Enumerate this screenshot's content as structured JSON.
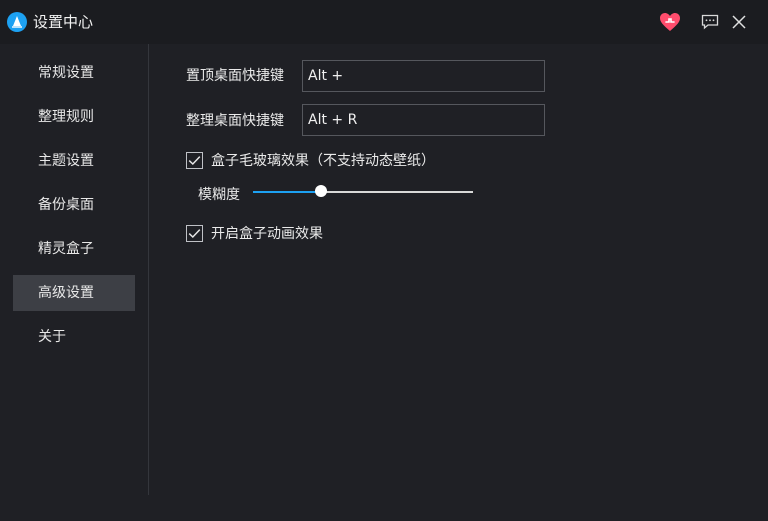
{
  "window": {
    "title": "设置中心",
    "icons": {
      "logo": "app-logo-icon",
      "favorite": "heart-icon",
      "feedback": "chat-bubble-icon",
      "close": "close-icon"
    },
    "colors": {
      "accent": "#1da1f2",
      "heart": "#ff4d6d"
    }
  },
  "sidebar": {
    "items": [
      {
        "label": "常规设置",
        "active": false
      },
      {
        "label": "整理规则",
        "active": false
      },
      {
        "label": "主题设置",
        "active": false
      },
      {
        "label": "备份桌面",
        "active": false
      },
      {
        "label": "精灵盒子",
        "active": false
      },
      {
        "label": "高级设置",
        "active": true
      },
      {
        "label": "关于",
        "active": false
      }
    ]
  },
  "advanced": {
    "pin_hotkey": {
      "label": "置顶桌面快捷键",
      "value": "Alt + "
    },
    "organize_hotkey": {
      "label": "整理桌面快捷键",
      "value": "Alt + R"
    },
    "frosted_glass": {
      "label": "盒子毛玻璃效果（不支持动态壁纸）",
      "checked": true
    },
    "blur": {
      "label": "模糊度",
      "value_percent": 31
    },
    "box_animation": {
      "label": "开启盒子动画效果",
      "checked": true
    }
  }
}
